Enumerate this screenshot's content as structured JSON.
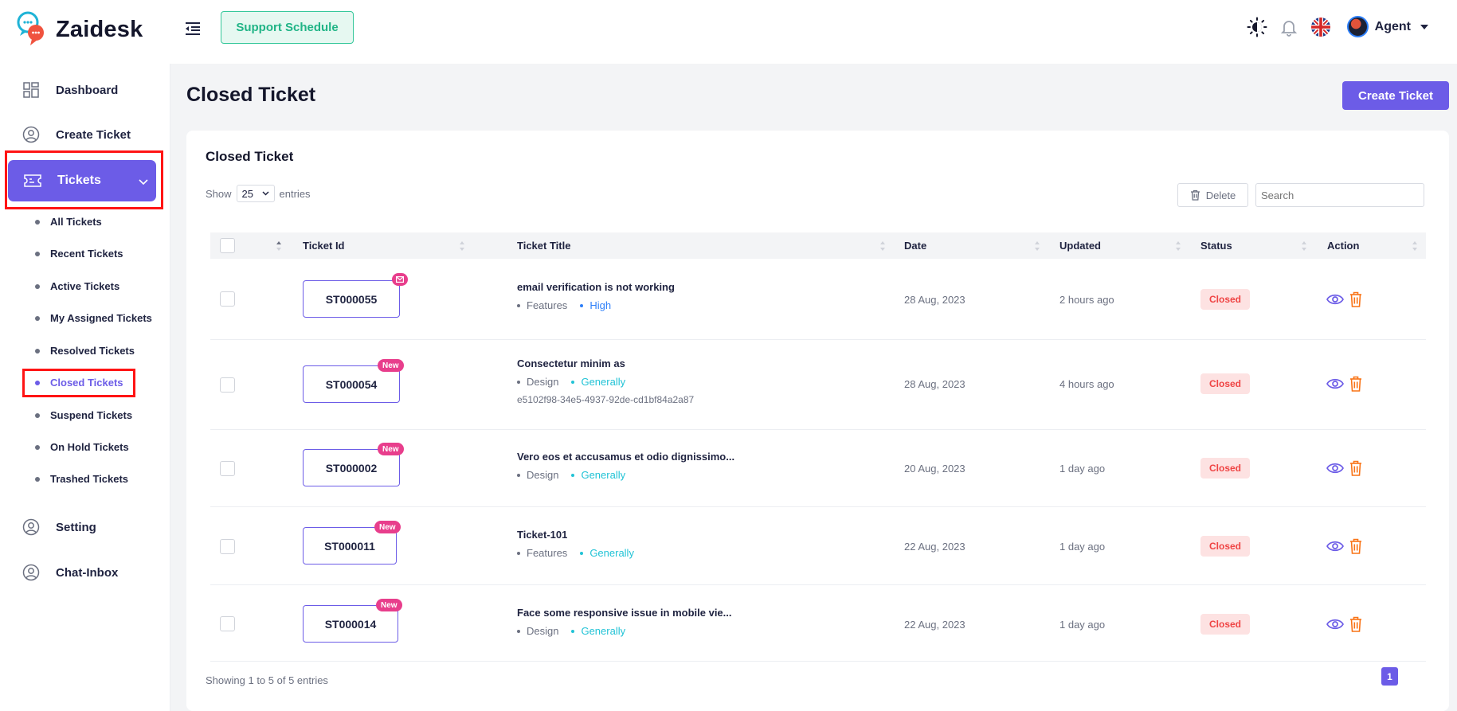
{
  "app": {
    "name": "Zaidesk"
  },
  "header": {
    "support_schedule": "Support Schedule",
    "user_name": "Agent"
  },
  "sidebar": {
    "items": [
      {
        "label": "Dashboard",
        "icon": "dashboard-icon"
      },
      {
        "label": "Create Ticket",
        "icon": "user-circle-icon"
      },
      {
        "label": "Tickets",
        "icon": "ticket-icon"
      },
      {
        "label": "Setting",
        "icon": "user-circle-icon"
      },
      {
        "label": "Chat-Inbox",
        "icon": "user-circle-icon"
      }
    ],
    "sub_items": [
      "All Tickets",
      "Recent Tickets",
      "Active Tickets",
      "My Assigned Tickets",
      "Resolved Tickets",
      "Closed Tickets",
      "Suspend Tickets",
      "On Hold Tickets",
      "Trashed Tickets"
    ],
    "active_sub": "Closed Tickets"
  },
  "page": {
    "title": "Closed Ticket",
    "create_button": "Create Ticket"
  },
  "card": {
    "title": "Closed Ticket",
    "show_label": "Show",
    "entries_value": "25",
    "entries_label": "entries",
    "delete_label": "Delete",
    "search_placeholder": "Search",
    "footer": "Showing 1 to 5 of 5 entries",
    "current_page": "1"
  },
  "table": {
    "columns": [
      "Ticket Id",
      "Ticket Title",
      "Date",
      "Updated",
      "Status",
      "Action"
    ],
    "rows": [
      {
        "id": "ST000055",
        "badge": "mail",
        "title": "email verification is not working",
        "tag1": "Features",
        "tag2": "High",
        "tag2_color": "#2d7ff9",
        "hash": "",
        "date": "28 Aug, 2023",
        "updated": "2 hours ago",
        "status": "Closed"
      },
      {
        "id": "ST000054",
        "badge": "New",
        "title": "Consectetur minim as",
        "tag1": "Design",
        "tag2": "Generally",
        "tag2_color": "#22c3d6",
        "hash": "e5102f98-34e5-4937-92de-cd1bf84a2a87",
        "date": "28 Aug, 2023",
        "updated": "4 hours ago",
        "status": "Closed"
      },
      {
        "id": "ST000002",
        "badge": "New",
        "title": "Vero eos et accusamus et odio dignissimo...",
        "tag1": "Design",
        "tag2": "Generally",
        "tag2_color": "#22c3d6",
        "hash": "",
        "date": "20 Aug, 2023",
        "updated": "1 day ago",
        "status": "Closed"
      },
      {
        "id": "ST000011",
        "badge": "New",
        "title": "Ticket-101",
        "tag1": "Features",
        "tag2": "Generally",
        "tag2_color": "#22c3d6",
        "hash": "",
        "date": "22 Aug, 2023",
        "updated": "1 day ago",
        "status": "Closed"
      },
      {
        "id": "ST000014",
        "badge": "New",
        "title": "Face some responsive issue in mobile vie...",
        "tag1": "Design",
        "tag2": "Generally",
        "tag2_color": "#22c3d6",
        "hash": "",
        "date": "22 Aug, 2023",
        "updated": "1 day ago",
        "status": "Closed"
      }
    ]
  },
  "colors": {
    "accent": "#6c5ce7",
    "support": "#20b486",
    "badge": "#e83e8c",
    "closed": "#ef4444",
    "highlight": "#ff1414"
  }
}
